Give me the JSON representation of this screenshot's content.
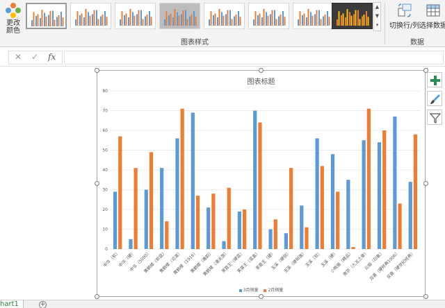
{
  "ribbon": {
    "change_color_label_1": "更改",
    "change_color_label_2": "颜色",
    "chart_styles_group": "图表样式",
    "data_group": "数据",
    "switch_row_col": "切换行/列",
    "select_data": "选择数据"
  },
  "formula_bar": {
    "cancel_icon": "✕",
    "enter_icon": "✓",
    "fx_label": "fx",
    "value": ""
  },
  "sheet_tab": "hart1",
  "add_sheet": "+",
  "colors": {
    "series1": "#5b9bd5",
    "series2": "#ed7d31",
    "axis_text": "#595959",
    "grid": "#d9d9d9"
  },
  "chart_data": {
    "type": "bar",
    "title": "图表标题",
    "ylim": [
      0,
      80
    ],
    "yticks": [
      0,
      10,
      20,
      30,
      40,
      50,
      60,
      70,
      80
    ],
    "grid": true,
    "legend": "bottom",
    "categories": [
      "中华（软）",
      "中华（硬）",
      "中华（5000）",
      "黄鹤楼（软蓝）",
      "黄鹤楼（论道）",
      "黄鹤楼（1916）",
      "黄鹤楼（雅韵）",
      "黄鹤楼（漫天游）",
      "芙蓉王（硬蓝）",
      "芙蓉王（蓝盒）",
      "芙蓉王（硬）",
      "玉溪（硬创）",
      "玉溪（硬和谐）",
      "玉溪（软）",
      "玉溪（硬）",
      "小熊猫（精品）",
      "南京（九五之尊）",
      "云烟（印象）",
      "双喜（硬经典1906）",
      "双喜（硬世纪经典）"
    ],
    "series": [
      {
        "name": "3月销量",
        "values": [
          29,
          5,
          30,
          41,
          56,
          69,
          21,
          4,
          19,
          70,
          10,
          8,
          22,
          56,
          48,
          35,
          55,
          54,
          67,
          34
        ]
      },
      {
        "name": "2月销量",
        "values": [
          57,
          41,
          49,
          14,
          71,
          27,
          28,
          31,
          20,
          64,
          15,
          41,
          11,
          42,
          29,
          1,
          71,
          60,
          23,
          58
        ]
      }
    ]
  }
}
